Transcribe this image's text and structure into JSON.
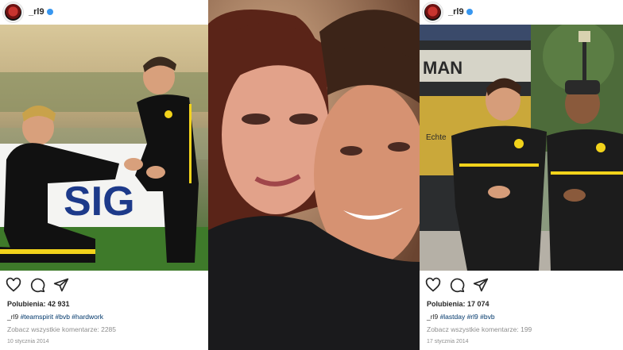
{
  "posts": [
    {
      "username": "_rl9",
      "likes": "Polubienia: 42 931",
      "caption_user": "_rl9",
      "caption_tags": "#teamspirit #bvb #hardwork",
      "comments": "Zobacz wszystkie komentarze: 2285",
      "date": "10 stycznia 2014"
    },
    {
      "username": "_rl9",
      "likes": "Polubienia: 17 074",
      "caption_user": "_rl9",
      "caption_tags": "#lastday #rl9 #bvb",
      "comments": "Zobacz wszystkie komentarze: 199",
      "date": "17 stycznia 2014"
    }
  ],
  "photo_texts": {
    "sign_left": "SIG",
    "bus_text": "MAN",
    "bus_side": "Echte"
  },
  "icons": [
    "heart-icon",
    "comment-icon",
    "share-icon",
    "verified-badge-icon"
  ],
  "colors": {
    "link": "#00376b",
    "meta": "#8e8e8e",
    "verified": "#3897f0"
  }
}
